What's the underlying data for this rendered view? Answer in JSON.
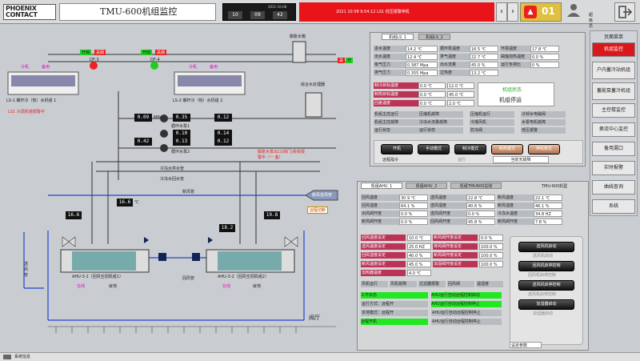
{
  "header": {
    "logo": "PHOENIX CONTACT",
    "title": "TMU-600机组监控",
    "clock_date": "2021-10-08",
    "clock_digits": [
      "10",
      "09",
      "42"
    ],
    "alarm_text": "2021 10 08 9:54:12 LS1 低压报警停机",
    "alarm_count": "01",
    "user_label": "超级员"
  },
  "nav": {
    "title": "页面菜单",
    "items": [
      "机组监控",
      "户内蓄冷站机组",
      "蓄能泵蓄冷机组",
      "主控楼监控",
      "换流中心监控",
      "备用漏口",
      "实时报警",
      "曲线查询",
      "系统"
    ],
    "active": 0
  },
  "chillers": [
    {
      "name": "LS-1 螺杆冷（热）水机组 1",
      "st1": "开阀",
      "st2": "关阀",
      "mode1": "开阀",
      "mode2": "关阀",
      "label": "冷机",
      "pump_label": "备用"
    },
    {
      "name": "LS-2 螺杆冷（热）水机组 2",
      "st1": "开阀",
      "st2": "关阀",
      "mode1": "开阀",
      "mode2": "关阀",
      "label": "冷机",
      "pump_label": "备用"
    }
  ],
  "valves": {
    "df3": "DF-3",
    "df4": "DF-4"
  },
  "warn_left": "LS1 冷源机组报警中",
  "tank": {
    "label": "膨胀水箱",
    "pump_label": "综合水处理器"
  },
  "pumps": [
    {
      "name": "循环水泵1",
      "p_in": "0.09",
      "p_out": "0.35",
      "p_out2": "0.12",
      "unit": "MPa"
    },
    {
      "name": "循环水泵1",
      "p_in": "",
      "p_out": "0.10",
      "p_out2": "0.14",
      "unit": "MPa"
    },
    {
      "name": "循环水泵2",
      "p_in": "0.42",
      "p_out": "0.13",
      "p_out2": "0.12",
      "unit": "MPa"
    }
  ],
  "pipes": {
    "supply": "冷冻水供水管",
    "return": "冷冻水回水管",
    "fresh": "新风管",
    "air_supply": "送风管",
    "return_air": "回风管"
  },
  "temps": {
    "t1": "16.6",
    "t2": "16.6",
    "t3": "19.8",
    "t4": "18.2",
    "unit": "℃"
  },
  "right_warn": "膨胀水泵出口(阀门)系统报警中（一 备）",
  "wind_switch": "远程切断",
  "inlet": "新风进风管",
  "ahus": [
    {
      "name": "AHU-3-1（回风空调机组1）",
      "status": "就地",
      "mode": "在线"
    },
    {
      "name": "AHU-3-2（回风空调机组2）",
      "status": "就地",
      "mode": "在线"
    }
  ],
  "room": "阀厅",
  "ls_panel": {
    "tabs": [
      "机组LS_1",
      "机组LS_2"
    ],
    "rows": [
      [
        "进水温度",
        "14.2 ℃",
        "循环泵温度",
        "16.5 ℃",
        "环境温度",
        "17.8 ℃"
      ],
      [
        "出水温度",
        "12.4 ℃",
        "排气温度",
        "22.7 ℃",
        "曲轴加热温度",
        "0.0 %"
      ],
      [
        "吸气压力",
        "0.387 Mpa",
        "出水流量",
        "45.0 %",
        "运行负荷比",
        "0 %"
      ],
      [
        "排气压力",
        "0.355 Mpa",
        "过热度",
        "13.2 ℃",
        "",
        ""
      ]
    ],
    "set_rows": [
      [
        "制冷目标温度",
        "0.0 ℃",
        "12.0 ℃"
      ],
      [
        "制热目标温度",
        "0.0 ℃",
        "45.0 ℃"
      ],
      [
        "回差温度",
        "0.0 ℃",
        "2.0 ℃"
      ]
    ],
    "state_title": "机组状态",
    "state": "机组停运",
    "lamps": [
      [
        "机组主控运行",
        "压缩机故障",
        "压缩机运行",
        "冷却水电磁阀"
      ],
      [
        "机组主控故障",
        "冷冻水流量故障",
        "冷凝风机",
        "水泵电机故障"
      ],
      [
        "运行状态",
        "运行状态",
        "防冻阀",
        "低压报警"
      ]
    ],
    "buttons": [
      "开机",
      "手动模式",
      "制冷模式",
      "制热模式",
      "停机复位"
    ],
    "btn_sub": [
      "运行",
      "",
      "运行",
      "",
      "运行"
    ],
    "cmd_label": "远程指令",
    "cmd_value": "当前无故障"
  },
  "ahu_panel": {
    "tabs": [
      "机组AHU_1",
      "机组AHU_2",
      "机组TMU600总线"
    ],
    "title": "TMU-600机型",
    "rows": [
      [
        "回风温度",
        "30.9 ℃",
        "送风温度",
        "22.8 ℃",
        "新风温度",
        "22.1 ℃"
      ],
      [
        "回风湿度",
        "64.1 %",
        "送风湿度",
        "40.6 %",
        "新风湿度",
        "46.1 %"
      ],
      [
        "出风阀开度",
        "0.0 %",
        "送风阀开度",
        "0.0 %",
        "冷冻水温度",
        "34.8 HZ"
      ],
      [
        "新风阀开度",
        "0.0 %",
        "回风阀开度",
        "45.8 %",
        "新风阀开度",
        "7.8 %"
      ]
    ],
    "set_rows": [
      [
        "回风温度设定",
        "10.0 ℃",
        "新风阀开度设定",
        "0.0 %"
      ],
      [
        "送风温度设定",
        "25.0 HZ",
        "排风阀开度设定",
        "100.0 %"
      ],
      [
        "回风湿度设定",
        "40.0 %",
        "新风阀开度设定",
        "100.0 %"
      ],
      [
        "新风温度设定",
        "45.0 %",
        "加湿阀开度设定",
        "100.0 %"
      ],
      [
        "加热器温度",
        "4.0 ℃",
        "",
        ""
      ]
    ],
    "mid_row": [
      "风机运行",
      "风机故障",
      "过滤器报警",
      "回风阀",
      "温湿度"
    ],
    "status": [
      [
        "工作状态",
        "AHU运行自动远程控制启动"
      ],
      [
        "运行方式：远程开",
        "AHU运行自动远程控制停止"
      ],
      [
        "本地模式：远程开",
        "AHU运行自动远程控制停止"
      ],
      [
        "远程开机",
        "AHU运行自动远程控制停止"
      ]
    ],
    "side_buttons": [
      "送风机启动",
      "送风机启动",
      "回风机启停控制",
      "回风机启停控制",
      "送风机启停控制",
      "送风机启停控制",
      "加湿器启动",
      "加湿器启动"
    ],
    "note": "设定参数"
  },
  "footer": {
    "label": "系统信息"
  }
}
